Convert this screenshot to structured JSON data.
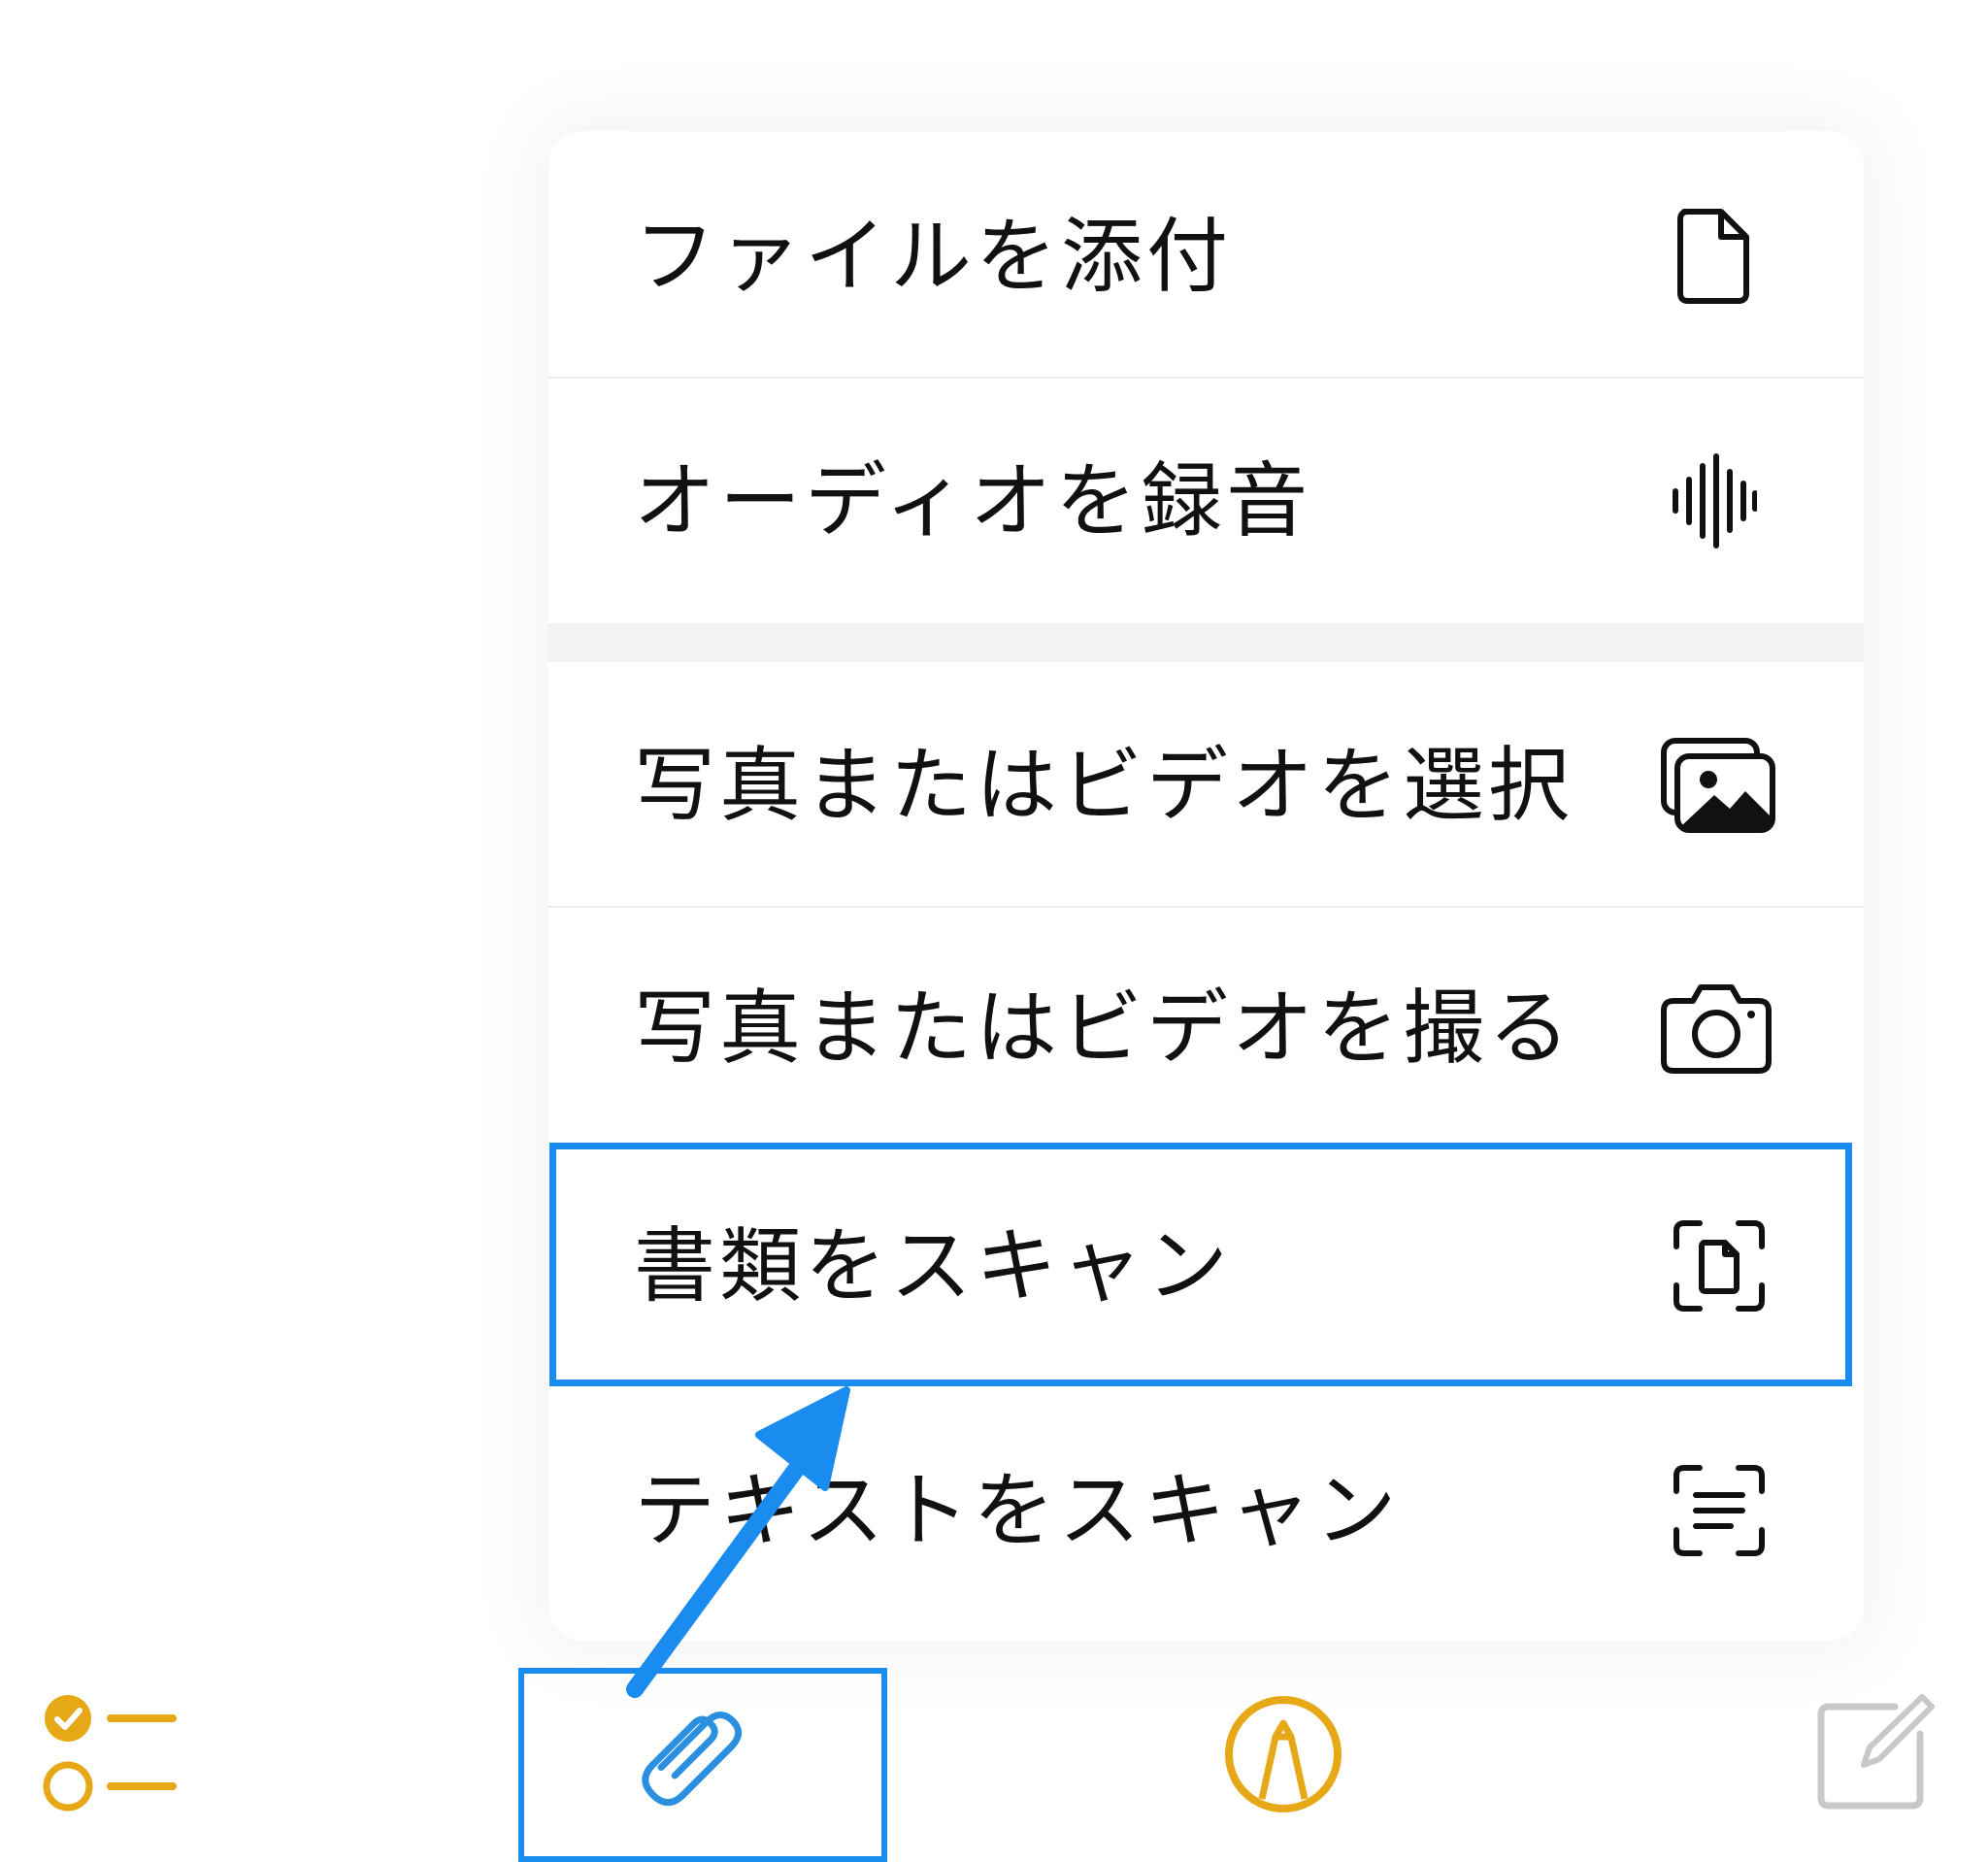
{
  "menu": {
    "items": [
      {
        "label": "ファイルを添付",
        "icon": "document-icon"
      },
      {
        "label": "オーディオを録音",
        "icon": "waveform-icon"
      },
      {
        "label": "写真またはビデオを選択",
        "icon": "photo-library-icon"
      },
      {
        "label": "写真またはビデオを撮る",
        "icon": "camera-icon"
      },
      {
        "label": "書類をスキャン",
        "icon": "doc-scan-icon"
      },
      {
        "label": "テキストをスキャン",
        "icon": "text-scan-icon"
      }
    ]
  },
  "toolbar": {
    "items": [
      {
        "name": "checklist",
        "icon": "checklist-icon"
      },
      {
        "name": "attach",
        "icon": "paperclip-icon"
      },
      {
        "name": "markup",
        "icon": "markup-pen-icon"
      },
      {
        "name": "compose",
        "icon": "compose-icon"
      }
    ]
  },
  "colors": {
    "highlight": "#1a8cf0",
    "accent_yellow": "#e6a817",
    "attach_blue": "#2b8fe0",
    "compose_gray": "#c8c8c8"
  }
}
